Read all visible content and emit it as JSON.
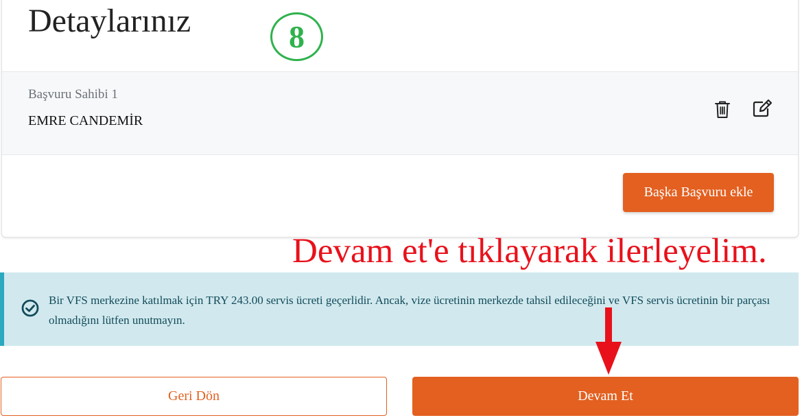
{
  "header": {
    "title": "Detaylarınız",
    "step_number": "8"
  },
  "applicant": {
    "label": "Başvuru Sahibi 1",
    "name": "EMRE CANDEMİR",
    "icons": [
      "trash-icon",
      "edit-icon"
    ]
  },
  "actions": {
    "add_applicant_label": "Başka Başvuru ekle",
    "back_label": "Geri Dön",
    "continue_label": "Devam Et"
  },
  "annotation": {
    "text": "Devam et'e tıklayarak ilerleyelim."
  },
  "alert": {
    "icon": "check-circle-icon",
    "text": "Bir VFS merkezine katılmak için TRY 243.00 servis ücreti geçerlidir. Ancak, vize ücretinin merkezde tahsil edileceğini ve VFS servis ücretinin bir parçası olmadığını lütfen unutmayın."
  },
  "colors": {
    "accent": "#e36020",
    "annotation": "#e8111b",
    "step_badge": "#2fb24d",
    "alert_bg": "#d1e9ee",
    "alert_border": "#2aa9bf"
  }
}
